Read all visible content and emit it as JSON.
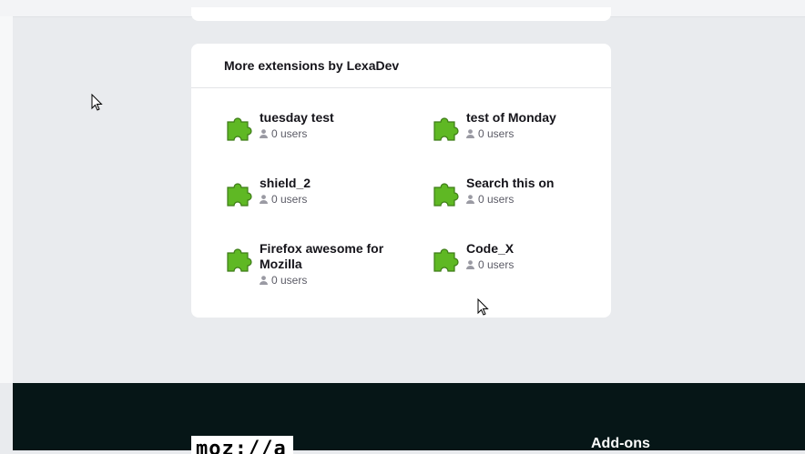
{
  "section": {
    "title": "More extensions by LexaDev",
    "extensions": [
      {
        "name": "tuesday test",
        "users": "0 users"
      },
      {
        "name": "test of Monday",
        "users": "0 users"
      },
      {
        "name": "shield_2",
        "users": "0 users"
      },
      {
        "name": "Search this on",
        "users": "0 users"
      },
      {
        "name": "Firefox awesome for Mozilla",
        "users": "0 users"
      },
      {
        "name": "Code_X",
        "users": "0 users"
      }
    ],
    "icon": "puzzle-piece-icon",
    "icon_color": "#5fb824"
  },
  "footer": {
    "logo_text": "moz://a",
    "heading": "Add-ons",
    "background": "#061617"
  }
}
